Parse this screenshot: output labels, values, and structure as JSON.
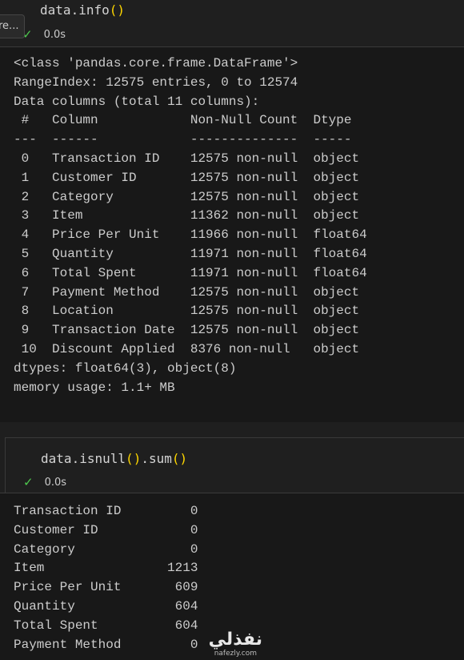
{
  "cell1": {
    "code": "data.info()",
    "status_time": "0.0s",
    "badge_text": "re..."
  },
  "output1": {
    "lines": [
      "<class 'pandas.core.frame.DataFrame'>",
      "RangeIndex: 12575 entries, 0 to 12574",
      "Data columns (total 11 columns):",
      " #   Column            Non-Null Count  Dtype  ",
      "---  ------            --------------  -----  ",
      " 0   Transaction ID    12575 non-null  object ",
      " 1   Customer ID       12575 non-null  object ",
      " 2   Category          12575 non-null  object ",
      " 3   Item              11362 non-null  object ",
      " 4   Price Per Unit    11966 non-null  float64",
      " 5   Quantity          11971 non-null  float64",
      " 6   Total Spent       11971 non-null  float64",
      " 7   Payment Method    12575 non-null  object ",
      " 8   Location          12575 non-null  object ",
      " 9   Transaction Date  12575 non-null  object ",
      " 10  Discount Applied  8376 non-null   object ",
      "dtypes: float64(3), object(8)",
      "memory usage: 1.1+ MB"
    ]
  },
  "cell2": {
    "code": "data.isnull().sum()",
    "status_time": "0.0s"
  },
  "output2": {
    "lines": [
      "Transaction ID         0",
      "Customer ID            0",
      "Category               0",
      "Item                1213",
      "Price Per Unit       609",
      "Quantity             604",
      "Total Spent          604",
      "Payment Method         0"
    ]
  },
  "watermark": {
    "logo": "نفذلي",
    "url": "nafezly.com"
  }
}
